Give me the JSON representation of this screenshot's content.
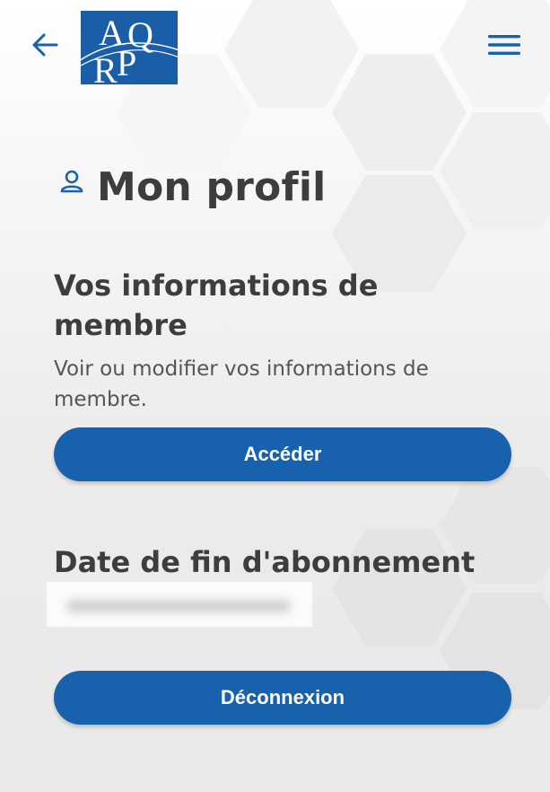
{
  "header": {
    "back_icon": "back-arrow-icon",
    "logo_letters": [
      "A",
      "Q",
      "R",
      "P"
    ],
    "menu_icon": "hamburger-menu-icon"
  },
  "profile": {
    "icon": "person-outline-icon",
    "title": "Mon profil"
  },
  "member_info": {
    "heading": "Vos informations de membre",
    "description": "Voir ou modifier vos informations de membre.",
    "button_label": "Accéder"
  },
  "subscription": {
    "heading": "Date de fin d'abonnement"
  },
  "logout": {
    "button_label": "Déconnexion"
  },
  "colors": {
    "accent": "#1862ad",
    "logo": "#1a5ea7",
    "text": "#3d3d3f"
  }
}
